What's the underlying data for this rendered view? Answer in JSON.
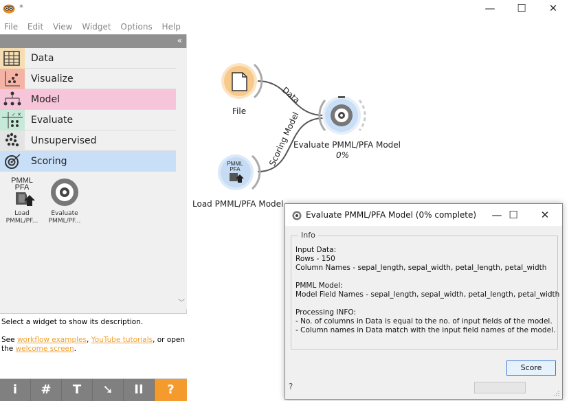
{
  "window": {
    "title": "*",
    "minimize": "—",
    "maximize": "☐",
    "close": "✕"
  },
  "menu": [
    "File",
    "Edit",
    "View",
    "Widget",
    "Options",
    "Help"
  ],
  "categories": [
    {
      "label": "Data",
      "color": "#f5e8c8"
    },
    {
      "label": "Visualize",
      "color": "#f4c7bd"
    },
    {
      "label": "Model",
      "color": "#f7c5d9"
    },
    {
      "label": "Evaluate",
      "color": "#d4f0e2"
    },
    {
      "label": "Unsupervised",
      "color": "#e7e7e7"
    },
    {
      "label": "Scoring",
      "color": "#c9dff7"
    }
  ],
  "widgets": [
    {
      "icon_text_1": "PMML",
      "icon_text_2": "PFA",
      "label_1": "Load",
      "label_2": "PMML/PF..."
    },
    {
      "label_1": "Evaluate",
      "label_2": "PMML/PF..."
    }
  ],
  "description": {
    "line1": "Select a widget to show its description.",
    "see": "See ",
    "link1": "workflow examples",
    "comma": ", ",
    "link2": "YouTube tutorials",
    "or_open": ", or open",
    "the": "the ",
    "link3": "welcome screen",
    "dot": "."
  },
  "toolbar": {
    "info": "i",
    "grid": "#",
    "text": "T",
    "arrow": "➘",
    "pause": "II",
    "help": "?"
  },
  "canvas": {
    "file_label": "File",
    "load_label": "Load PMML/PFA Model",
    "load_icon_1": "PMML",
    "load_icon_2": "PFA",
    "eval_label": "Evaluate PMML/PFA Model",
    "eval_progress": "0%",
    "link_data": "Data",
    "link_scoring": "Scoring Model"
  },
  "dialog": {
    "title": "Evaluate PMML/PFA Model (0% complete)",
    "group_title": "Info",
    "info": "Input Data:\nRows - 150\nColumn Names - sepal_length, sepal_width, petal_length, petal_width\n\nPMML Model:\nModel Field Names - sepal_length, sepal_width, petal_length, petal_width\n\nProcessing INFO:\n- No. of columns in Data is equal to the no. of input fields of the model.\n- Column names in Data match with the input field names of the model.",
    "score_button": "Score",
    "help": "?",
    "progress": 0
  },
  "colors": {
    "accent": "#f59b2e",
    "panel_head": "#909090",
    "score_border": "#3c78d8"
  }
}
